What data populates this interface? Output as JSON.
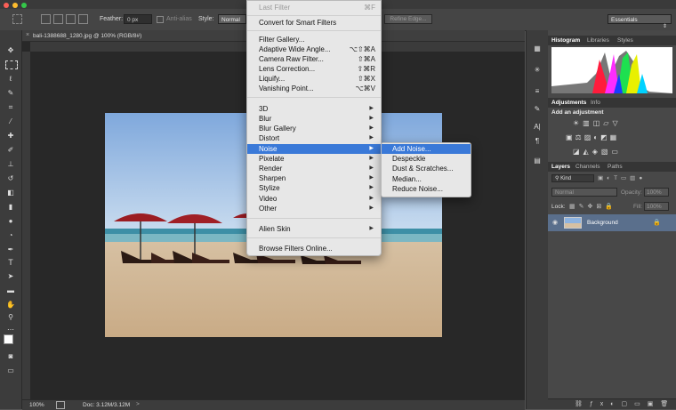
{
  "options_bar": {
    "feather_label": "Feather:",
    "feather_value": "0 px",
    "antialias_label": "Anti-alias",
    "style_label": "Style:",
    "style_value": "Normal",
    "refine_edge_label": "Refine Edge...",
    "workspace": "Essentials"
  },
  "document": {
    "tab_title": "bali-1388688_1280.jpg @ 100% (RGB/8#)",
    "zoom": "100%",
    "doc_info": "Doc: 3.12M/3.12M"
  },
  "filter_menu": {
    "items": [
      {
        "label": "Last Filter",
        "shortcut": "⌘F",
        "disabled": true
      },
      {
        "label": "Convert for Smart Filters"
      },
      {
        "label": "Filter Gallery..."
      },
      {
        "label": "Adaptive Wide Angle...",
        "shortcut": "⌥⇧⌘A"
      },
      {
        "label": "Camera Raw Filter...",
        "shortcut": "⇧⌘A"
      },
      {
        "label": "Lens Correction...",
        "shortcut": "⇧⌘R"
      },
      {
        "label": "Liquify...",
        "shortcut": "⇧⌘X"
      },
      {
        "label": "Vanishing Point...",
        "shortcut": "⌥⌘V"
      },
      {
        "label": "3D"
      },
      {
        "label": "Blur"
      },
      {
        "label": "Blur Gallery"
      },
      {
        "label": "Distort"
      },
      {
        "label": "Noise",
        "highlighted": true
      },
      {
        "label": "Pixelate"
      },
      {
        "label": "Render"
      },
      {
        "label": "Sharpen"
      },
      {
        "label": "Stylize"
      },
      {
        "label": "Video"
      },
      {
        "label": "Other"
      },
      {
        "label": "Alien Skin"
      },
      {
        "label": "Browse Filters Online..."
      }
    ],
    "submenu_arrow": "▶"
  },
  "noise_submenu": {
    "items": [
      {
        "label": "Add Noise...",
        "highlighted": true
      },
      {
        "label": "Despeckle"
      },
      {
        "label": "Dust & Scratches..."
      },
      {
        "label": "Median..."
      },
      {
        "label": "Reduce Noise..."
      }
    ]
  },
  "panels": {
    "histogram_tabs": [
      "Histogram",
      "Libraries",
      "Styles"
    ],
    "adjustments_tabs": [
      "Adjustments",
      "Info"
    ],
    "adjustments_title": "Add an adjustment",
    "layers_tabs": [
      "Layers",
      "Channels",
      "Paths"
    ],
    "kind_filter": "Kind",
    "blend_mode": "Normal",
    "opacity_label": "Opacity:",
    "opacity_value": "100%",
    "lock_label": "Lock:",
    "fill_label": "Fill:",
    "fill_value": "100%",
    "layer_name": "Background"
  },
  "colors": {
    "menu_highlight": "#3a79d8",
    "layer_selected": "#5a6f8c"
  }
}
